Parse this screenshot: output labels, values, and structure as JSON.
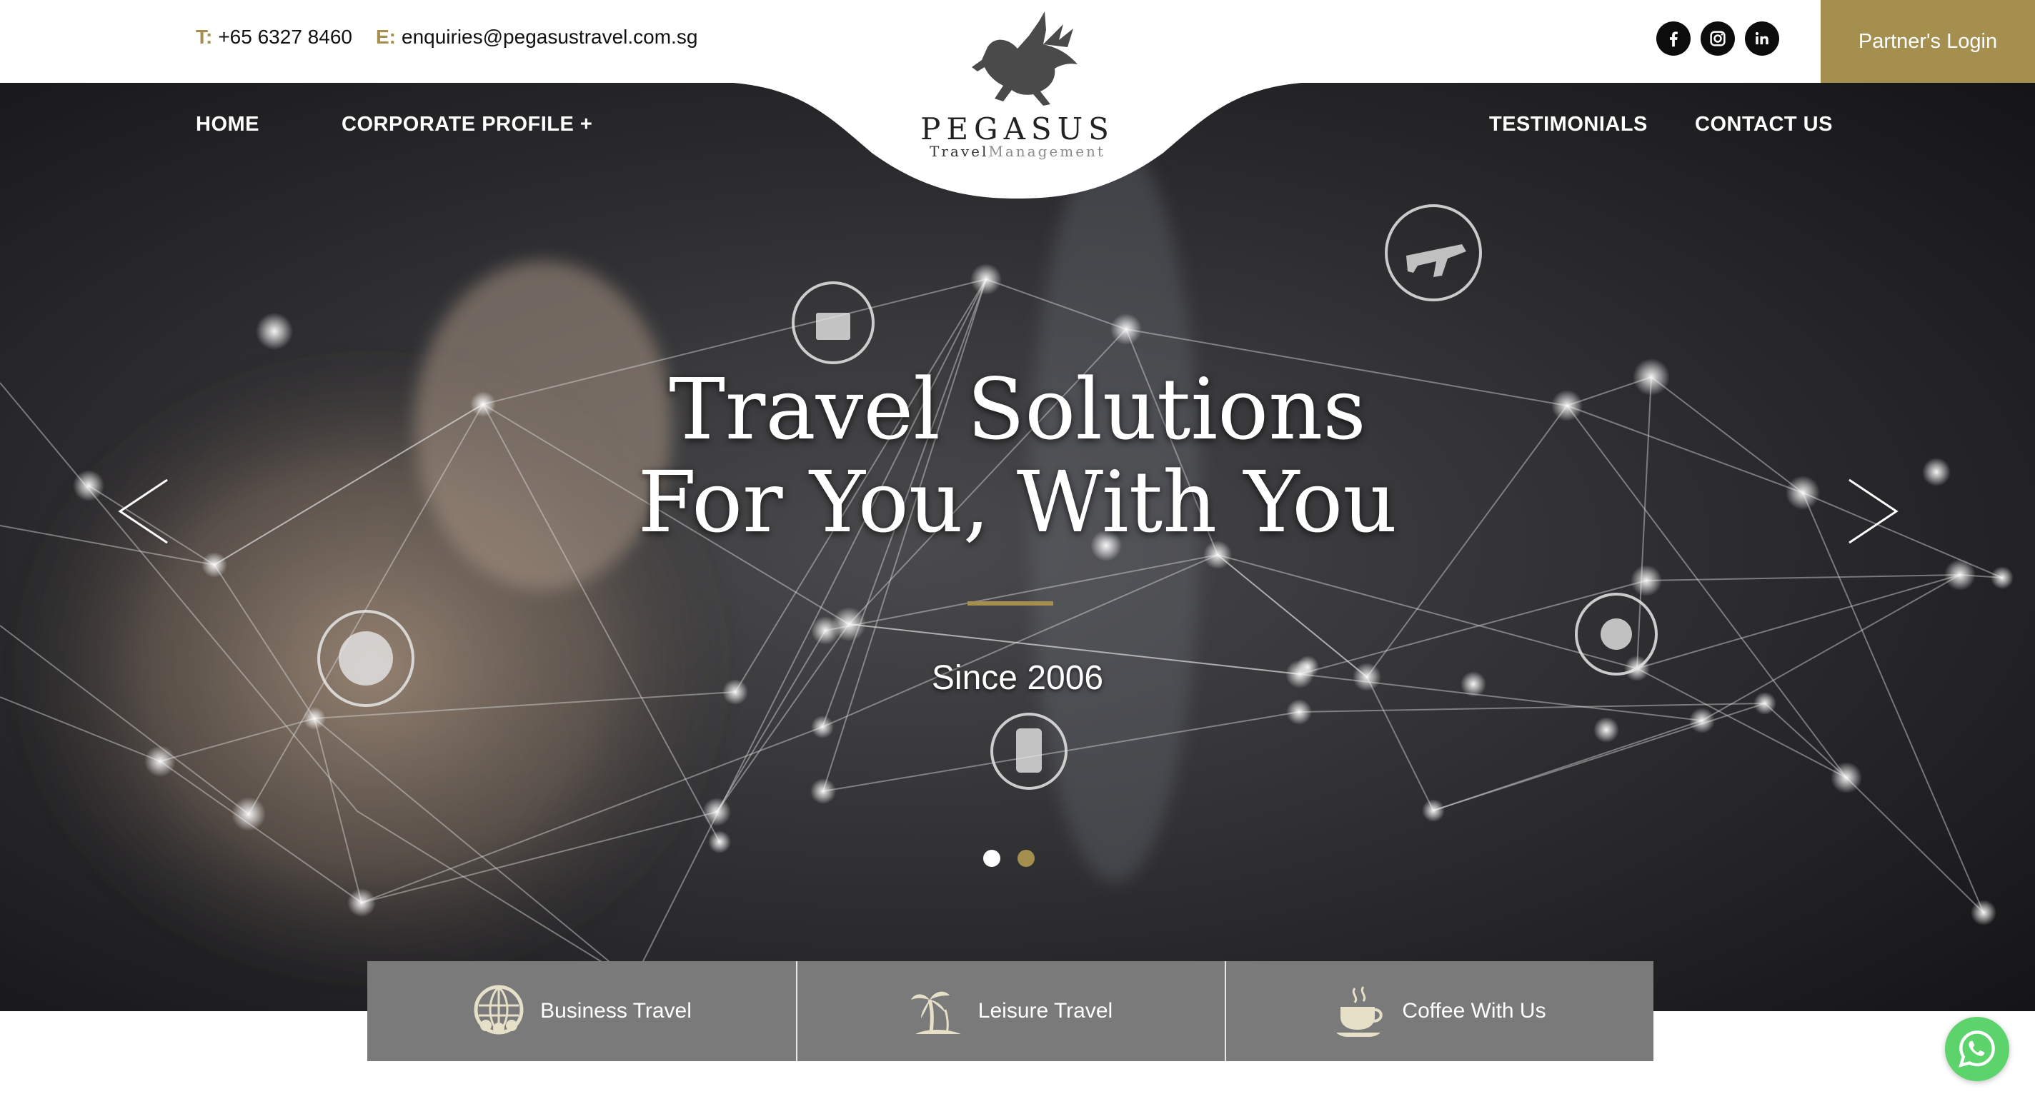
{
  "header": {
    "phone_key": "T:",
    "phone": "+65 6327 8460",
    "email_key": "E:",
    "email": "enquiries@pegasustravel.com.sg",
    "partner_login": "Partner's Login",
    "social": [
      "facebook-icon",
      "instagram-icon",
      "linkedin-icon"
    ]
  },
  "logo": {
    "brand": "PEGASUS",
    "tag_left": "Travel",
    "tag_right": "Management"
  },
  "nav": {
    "home": "HOME",
    "corporate_profile": "CORPORATE PROFILE +",
    "testimonials": "TESTIMONIALS",
    "contact_us": "CONTACT US"
  },
  "hero": {
    "headline_line1": "Travel Solutions",
    "headline_line2": "For You, With You",
    "since": "Since 2006",
    "slides": 2,
    "active_slide": 1
  },
  "services": [
    {
      "label": "Business Travel",
      "icon": "globe-people-icon"
    },
    {
      "label": "Leisure Travel",
      "icon": "palm-tree-icon"
    },
    {
      "label": "Coffee With Us",
      "icon": "coffee-cup-icon"
    }
  ],
  "colors": {
    "accent_gold": "#a58f4f",
    "service_bg": "#7a7a7a",
    "whatsapp": "#5dd36b"
  }
}
